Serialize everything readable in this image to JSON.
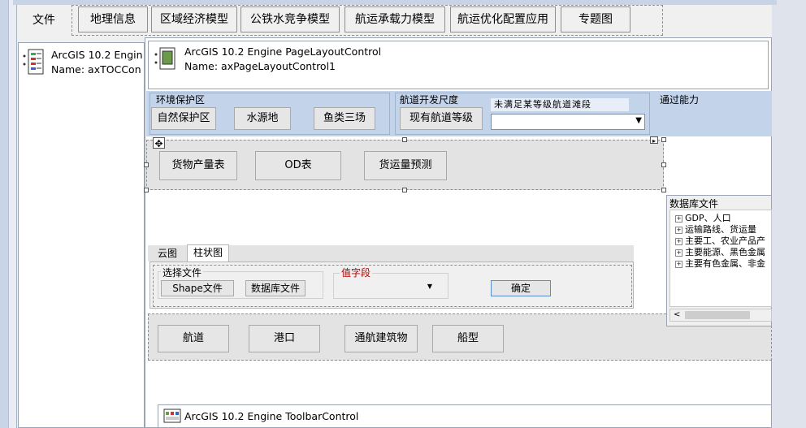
{
  "menu": {
    "file_label": "文件",
    "items": [
      "地理信息",
      "区域经济模型",
      "公铁水竞争模型",
      "航运承载力模型",
      "航运优化配置应用",
      "专题图"
    ]
  },
  "toc_control": {
    "line1": "ArcGIS 10.2 Engin",
    "line2": "Name: axTOCCon"
  },
  "pagelayout_control": {
    "line1": "ArcGIS 10.2 Engine PageLayoutControl",
    "line2": "Name: axPageLayoutControl1"
  },
  "env_group": {
    "title": "环境保护区",
    "buttons": [
      "自然保护区",
      "水源地",
      "鱼类三场"
    ]
  },
  "channel_group": {
    "title": "航道开发尺度",
    "button": "现有航道等级",
    "combo_label": "未满足某等级航道滩段",
    "combo_value": ""
  },
  "capacity_group": {
    "title": "通过能力"
  },
  "selection_buttons": [
    "货物产量表",
    "OD表",
    "货运量预测"
  ],
  "tabs": [
    "云图",
    "柱状图"
  ],
  "tab_content": {
    "file_group_title": "选择文件",
    "shape_button": "Shape文件",
    "db_button": "数据库文件",
    "field_group_title": "值字段",
    "field_value": "",
    "ok_button": "确定"
  },
  "bottom_buttons": [
    "航道",
    "港口",
    "通航建筑物",
    "船型"
  ],
  "db_panel": {
    "title": "数据库文件",
    "items": [
      "GDP、人口",
      "运输路线、货运量",
      "主要工、农业产品产",
      "主要能源、黑色金属",
      "主要有色金属、非金"
    ]
  },
  "toolbar_control": {
    "line1": "ArcGIS 10.2 Engine ToolbarControl"
  },
  "colors": {
    "band": "#c3d3ea",
    "window_frame": "#c7d4e6",
    "field_title": "#b00000"
  }
}
